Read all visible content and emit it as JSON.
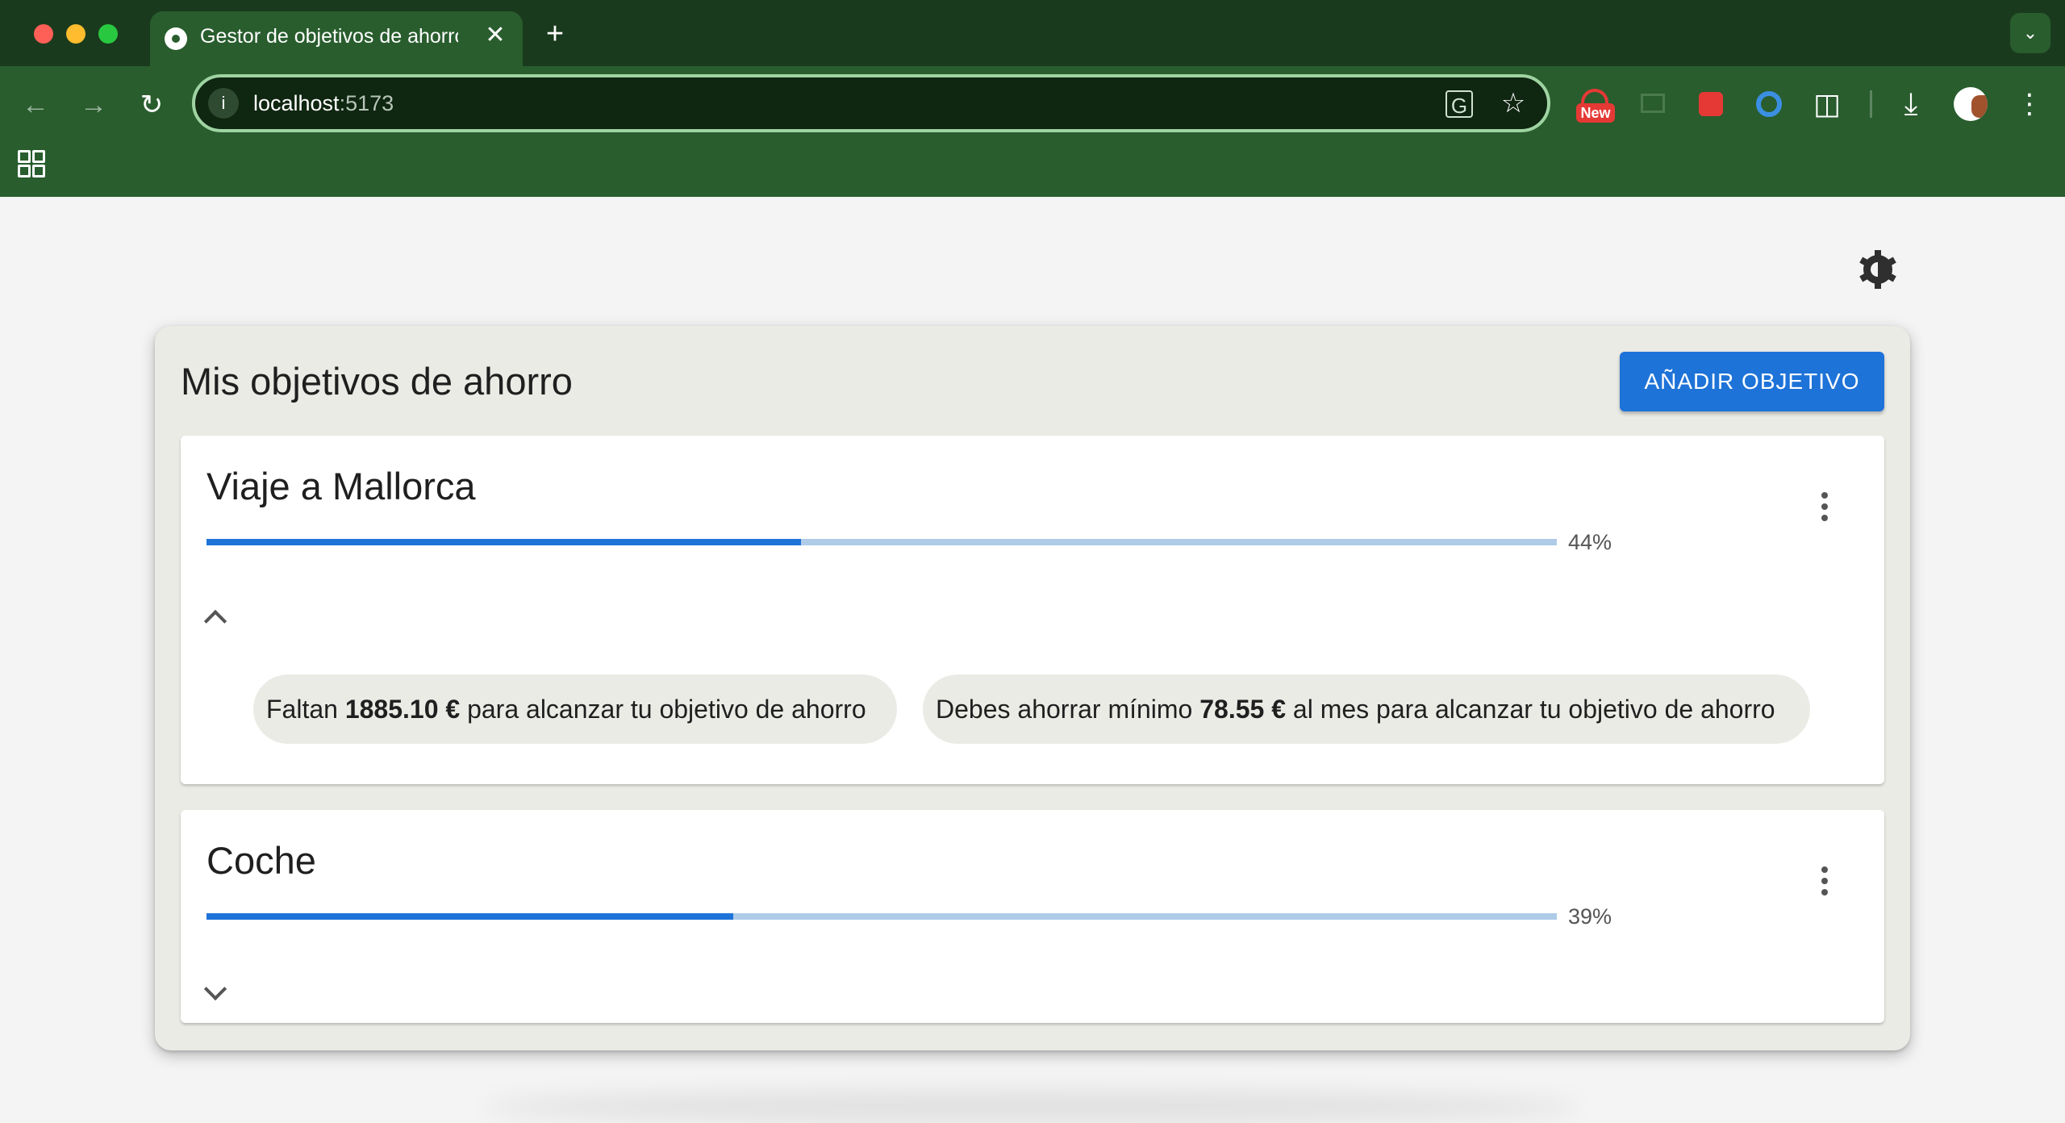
{
  "browser": {
    "tab_title": "Gestor de objetivos de ahorro",
    "url_host": "localhost",
    "url_port": ":5173",
    "new_tab_symbol": "+",
    "close_symbol": "✕",
    "extension_badge": "New"
  },
  "page": {
    "title": "Mis objetivos de ahorro",
    "add_button_label": "AÑADIR OBJETIVO",
    "accent_color": "#1e73d8"
  },
  "goals": [
    {
      "name": "Viaje a Mallorca",
      "progress": 0.44,
      "progress_label": "44%",
      "expanded": true,
      "chip1_prefix": "Faltan ",
      "chip1_amount": "1885.10 €",
      "chip1_suffix": " para alcanzar tu objetivo de ahorro",
      "chip2_prefix": "Debes ahorrar mínimo ",
      "chip2_amount": "78.55 €",
      "chip2_suffix": " al mes para alcanzar tu objetivo de ahorro"
    },
    {
      "name": "Coche",
      "progress": 0.39,
      "progress_label": "39%",
      "expanded": false
    }
  ]
}
